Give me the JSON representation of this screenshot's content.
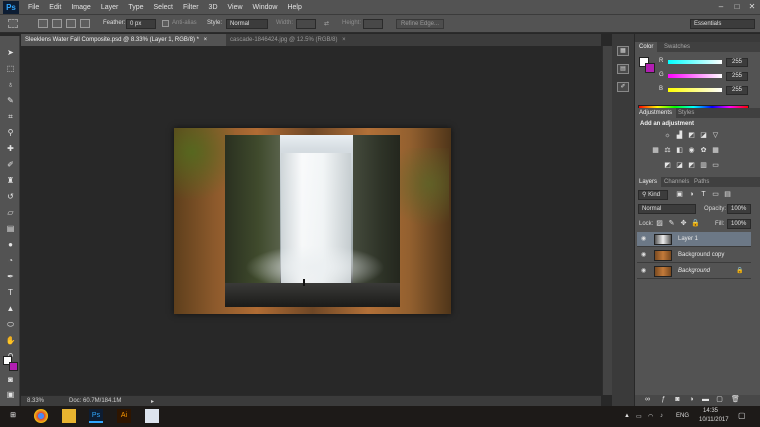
{
  "menu": {
    "logo": "Ps",
    "items": [
      "File",
      "Edit",
      "Image",
      "Layer",
      "Type",
      "Select",
      "Filter",
      "3D",
      "View",
      "Window",
      "Help"
    ]
  },
  "window_controls": {
    "minimize": "–",
    "maximize": "□",
    "close": "✕"
  },
  "options": {
    "feather_label": "Feather:",
    "feather_value": "0 px",
    "antialias_label": "Anti-alias",
    "style_label": "Style:",
    "style_value": "Normal",
    "width_label": "Width:",
    "height_label": "Height:",
    "refine_edge": "Refine Edge...",
    "workspace": "Essentials"
  },
  "doc_tabs": [
    {
      "label": "Sleeklens Water Fall Composite.psd @ 8.33% (Layer 1, RGB/8) *",
      "close": "×"
    },
    {
      "label": "cascade-1846424.jpg @ 12.5% (RGB/8)",
      "close": "×"
    }
  ],
  "status": {
    "zoom": "8.33%",
    "doc_size": "Doc: 60.7M/184.1M"
  },
  "color_panel": {
    "tabs": [
      "Color",
      "Swatches"
    ],
    "channels": [
      {
        "name": "R",
        "value": "255"
      },
      {
        "name": "G",
        "value": "255"
      },
      {
        "name": "B",
        "value": "255"
      }
    ]
  },
  "adjustments_panel": {
    "tabs": [
      "Adjustments",
      "Styles"
    ],
    "heading": "Add an adjustment"
  },
  "layers_panel": {
    "tabs": [
      "Layers",
      "Channels",
      "Paths"
    ],
    "kind": "Kind",
    "blend_mode": "Normal",
    "opacity_label": "Opacity:",
    "opacity_value": "100%",
    "lock_label": "Lock:",
    "fill_label": "Fill:",
    "fill_value": "100%",
    "layers": [
      {
        "name": "Layer 1",
        "selected": true
      },
      {
        "name": "Background copy",
        "selected": false
      },
      {
        "name": "Background",
        "selected": false,
        "locked": true
      }
    ]
  },
  "taskbar": {
    "language": "ENG",
    "time": "14:35",
    "date": "10/11/2017"
  },
  "colors": {
    "foreground": "#ffffff",
    "background": "#b21eb2",
    "accent": "#31a8ff"
  }
}
